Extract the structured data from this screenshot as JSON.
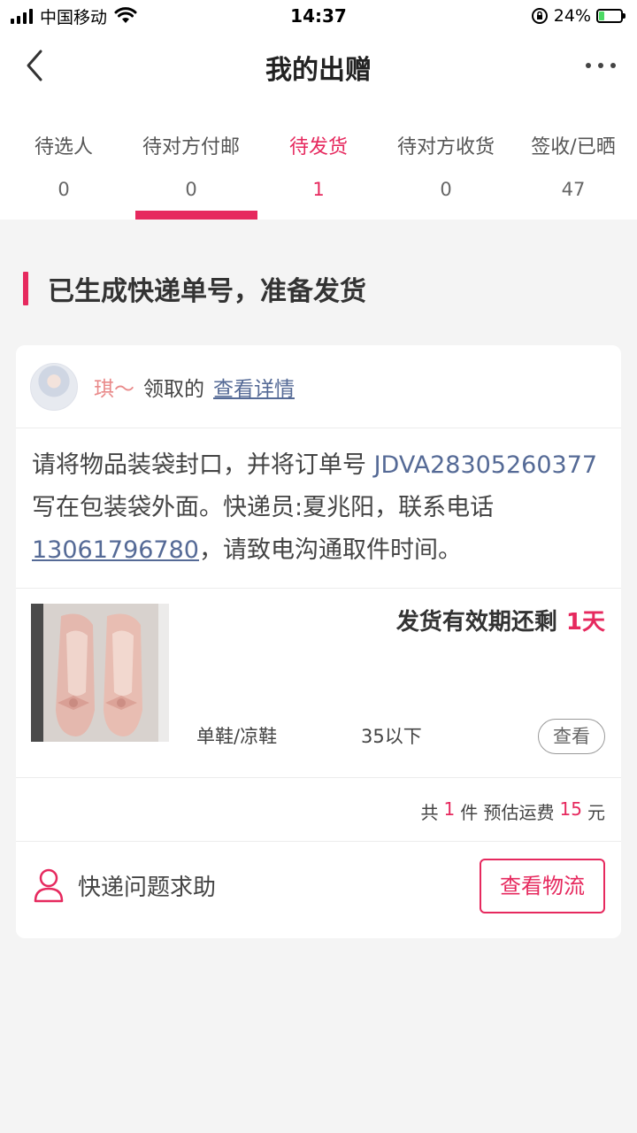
{
  "status_bar": {
    "carrier": "中国移动",
    "time": "14:37",
    "battery": "24%",
    "battery_level": 0.24,
    "icons": [
      "signal-icon",
      "wifi-icon",
      "rotation-lock-icon",
      "battery-icon"
    ]
  },
  "nav": {
    "title": "我的出赠",
    "back_icon": "chevron-left-icon",
    "more_icon": "more-dots-icon"
  },
  "tabs": [
    {
      "label": "待选人",
      "count": "0",
      "active": false
    },
    {
      "label": "待对方付邮",
      "count": "0",
      "active": false
    },
    {
      "label": "待发货",
      "count": "1",
      "active": true
    },
    {
      "label": "待对方收货",
      "count": "0",
      "active": false
    },
    {
      "label": "签收/已晒",
      "count": "47",
      "active": false
    }
  ],
  "section": {
    "title": "已生成快递单号，准备发货"
  },
  "card": {
    "receiver_name": "琪～",
    "receiver_action": "领取的",
    "detail_link": "查看详情",
    "instructions": {
      "part1": "请将物品装袋封口，并将订单号 ",
      "order_no": "JDVA28305260377",
      "part2": " 写在包装袋外面。快递员:夏兆阳，联系电话",
      "phone": "13061796780",
      "part3": "，请致电沟通取件时间。"
    },
    "deadline_label": "发货有效期还剩",
    "deadline_value": "1天",
    "product_category": "单鞋/凉鞋",
    "product_size": "35以下",
    "view_button": "查看",
    "summary": {
      "prefix": "共",
      "count": "1",
      "unit": "件 预估运费",
      "fee": "15",
      "currency": "元"
    },
    "help_label": "快递问题求助",
    "logistics_button": "查看物流"
  },
  "colors": {
    "accent": "#e6295e",
    "link": "#556a96",
    "background": "#f4f4f4"
  }
}
